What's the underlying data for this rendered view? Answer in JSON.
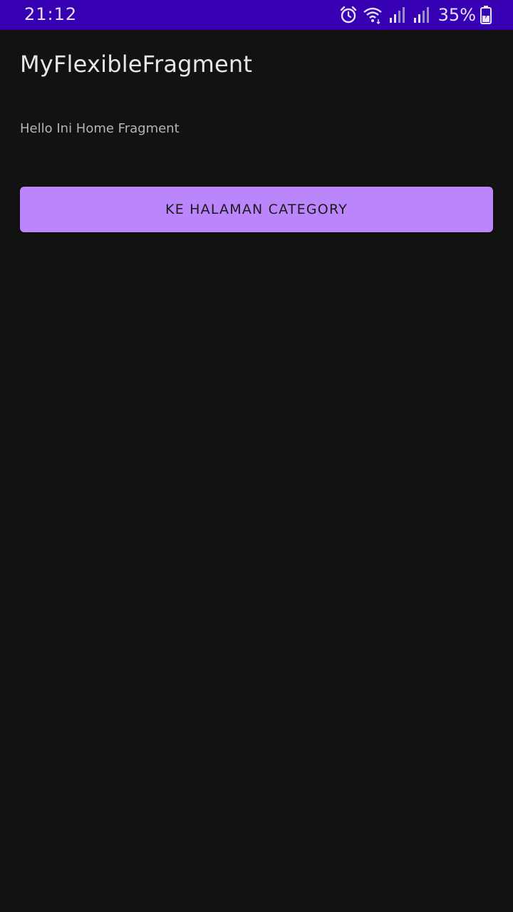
{
  "status_bar": {
    "time": "21:12",
    "battery_percent": "35%",
    "icons": [
      "alarm-icon",
      "wifi-icon",
      "signal-icon",
      "signal-icon",
      "battery-charging-icon"
    ],
    "background_color": "#3700B3"
  },
  "app": {
    "title": "MyFlexibleFragment",
    "home_text": "Hello Ini Home Fragment",
    "button_label": "KE HALAMAN CATEGORY",
    "accent_color": "#BB86FC",
    "background_color": "#121212"
  }
}
